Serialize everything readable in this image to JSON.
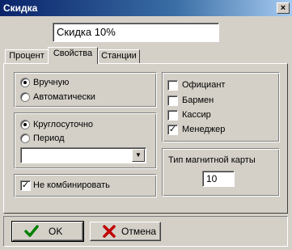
{
  "window": {
    "title": "Скидка",
    "close_glyph": "×"
  },
  "discount_name": {
    "value": "Скидка 10%"
  },
  "tabs": [
    {
      "label": "Процент",
      "active": false
    },
    {
      "label": "Свойства",
      "active": true
    },
    {
      "label": "Станции",
      "active": false
    }
  ],
  "mode": {
    "options": [
      {
        "label": "Вручную",
        "selected": true
      },
      {
        "label": "Автоматически",
        "selected": false
      }
    ]
  },
  "schedule": {
    "options": [
      {
        "label": "Круглосуточно",
        "selected": true
      },
      {
        "label": "Период",
        "selected": false
      }
    ],
    "period_value": ""
  },
  "no_combine": {
    "label": "Не комбинировать",
    "checked": true
  },
  "roles": [
    {
      "label": "Официант",
      "checked": false
    },
    {
      "label": "Бармен",
      "checked": false
    },
    {
      "label": "Кассир",
      "checked": false
    },
    {
      "label": "Менеджер",
      "checked": true
    }
  ],
  "card_type": {
    "label": "Тип магнитной карты",
    "value": "10"
  },
  "buttons": {
    "ok": {
      "label": "OK",
      "icon": "checkmark-icon",
      "color": "#008000"
    },
    "cancel": {
      "label": "Отмена",
      "icon": "cross-icon",
      "color": "#c00000"
    }
  },
  "check_glyph": "✓"
}
